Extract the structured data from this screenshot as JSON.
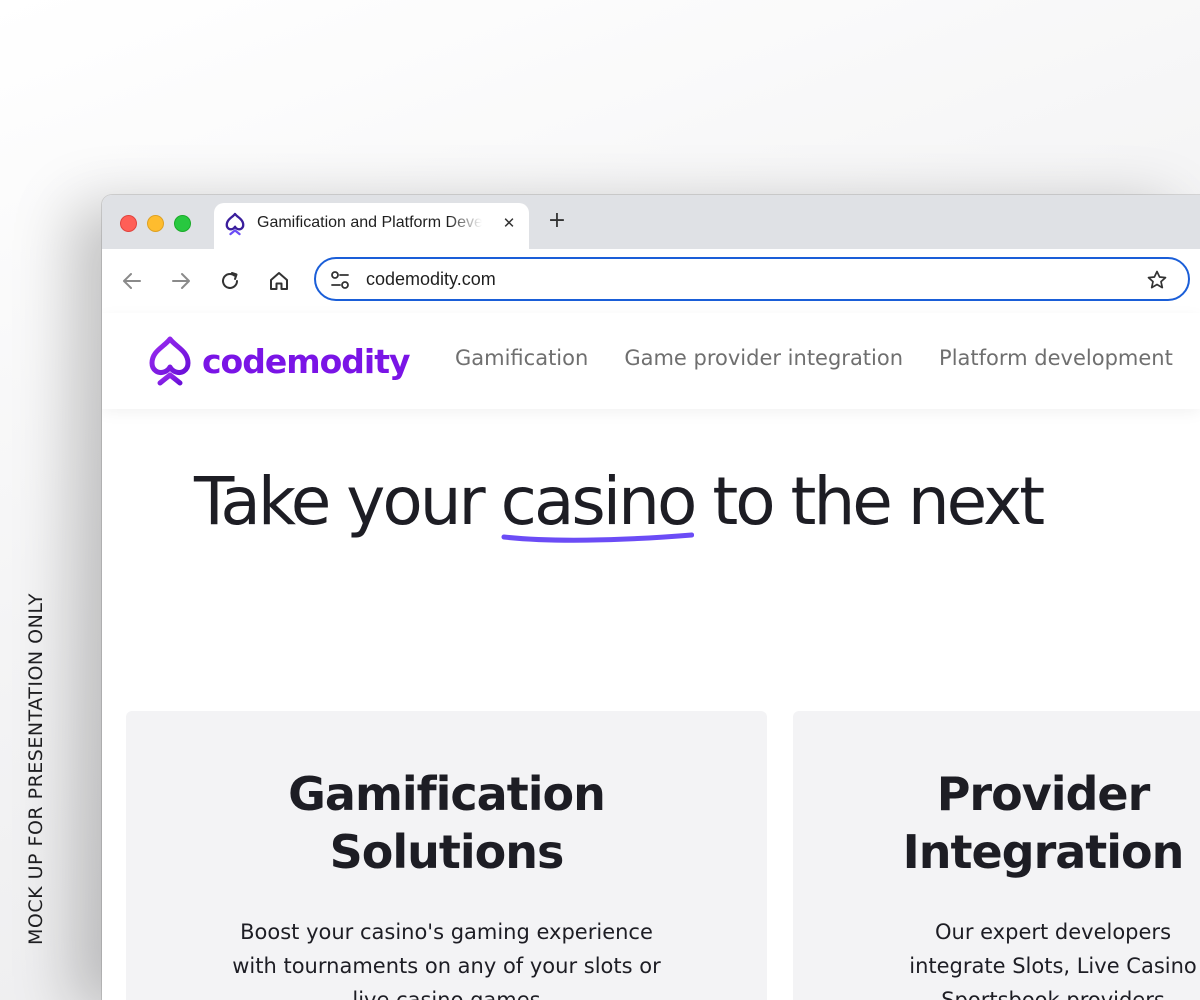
{
  "watermark": "MOCK UP FOR PRESENTATION ONLY",
  "browser": {
    "tab": {
      "title": "Gamification and Platform Development",
      "close_icon": "close-icon",
      "new_tab_label": "+"
    },
    "address_bar": {
      "url": "codemodity.com"
    }
  },
  "site": {
    "logo_text": "codemodity",
    "brand_color": "#7a14e6",
    "nav": [
      {
        "label": "Gamification"
      },
      {
        "label": "Game provider integration"
      },
      {
        "label": "Platform development"
      }
    ],
    "hero": {
      "before": "Take your ",
      "highlight": "casino",
      "after": " to the next",
      "underline_color": "#6b4cf6"
    },
    "cards": [
      {
        "title_line1": "Gamification",
        "title_line2": "Solutions",
        "text_line1": "Boost your casino's gaming experience",
        "text_line2": "with tournaments on any of your slots or",
        "text_line3": "live casino games"
      },
      {
        "title_line1": "Provider",
        "title_line2": "Integration",
        "text_line1": "Our expert developers",
        "text_line2": "integrate Slots, Live Casino",
        "text_line3": "Sportsbook providers"
      }
    ]
  }
}
